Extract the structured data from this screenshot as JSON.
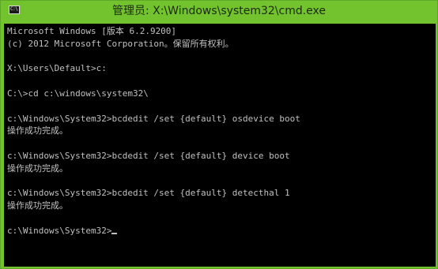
{
  "window": {
    "title": "管理员: X:\\Windows\\system32\\cmd.exe",
    "icon": "cmd-icon",
    "icon_glyph": "C:\\"
  },
  "console": {
    "lines": [
      "Microsoft Windows [版本 6.2.9200]",
      "(c) 2012 Microsoft Corporation。保留所有权利。",
      "",
      "X:\\Users\\Default>c:",
      "",
      "C:\\>cd c:\\windows\\system32\\",
      "",
      "c:\\Windows\\System32>bcdedit /set {default} osdevice boot",
      "操作成功完成。",
      "",
      "c:\\Windows\\System32>bcdedit /set {default} device boot",
      "操作成功完成。",
      "",
      "c:\\Windows\\System32>bcdedit /set {default} detecthal 1",
      "操作成功完成。",
      "",
      "c:\\Windows\\System32>"
    ]
  }
}
